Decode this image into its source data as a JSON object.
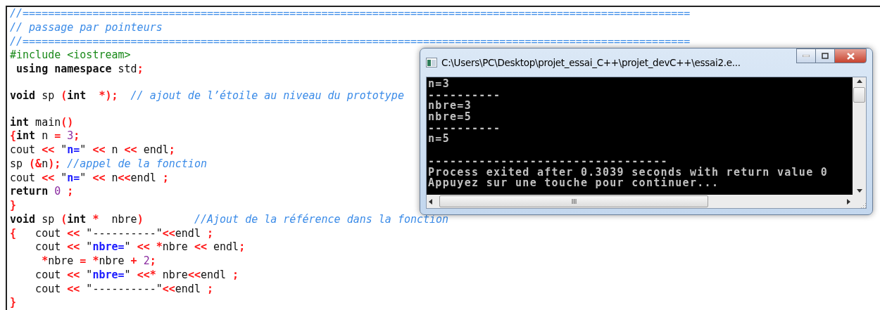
{
  "editor": {
    "lines": [
      {
        "kind": "code",
        "tokens": [
          {
            "kind": "comment",
            "text": "//========================================================================================================="
          }
        ]
      },
      {
        "kind": "code",
        "tokens": [
          {
            "kind": "comment",
            "text": "// passage par pointeurs"
          }
        ]
      },
      {
        "kind": "code",
        "tokens": [
          {
            "kind": "comment",
            "text": "//========================================================================================================="
          }
        ]
      },
      {
        "kind": "code",
        "tokens": [
          {
            "kind": "preproc",
            "text": "#include <iostream>"
          }
        ]
      },
      {
        "kind": "code",
        "tokens": [
          {
            "kind": "keyword",
            "text": " using namespace"
          },
          {
            "kind": "plain",
            "text": " std"
          },
          {
            "kind": "op",
            "text": ";"
          }
        ]
      },
      {
        "kind": "blank"
      },
      {
        "kind": "code",
        "tokens": [
          {
            "kind": "keyword",
            "text": "void"
          },
          {
            "kind": "plain",
            "text": " sp "
          },
          {
            "kind": "op",
            "text": "("
          },
          {
            "kind": "keyword",
            "text": "int"
          },
          {
            "kind": "op",
            "text": "  *);"
          },
          {
            "kind": "comment",
            "text": "  // ajout de l’étoile au niveau du prototype"
          }
        ]
      },
      {
        "kind": "blank"
      },
      {
        "kind": "code",
        "tokens": [
          {
            "kind": "keyword",
            "text": "int"
          },
          {
            "kind": "plain",
            "text": " main"
          },
          {
            "kind": "op",
            "text": "()"
          }
        ]
      },
      {
        "kind": "code",
        "tokens": [
          {
            "kind": "op",
            "text": "{"
          },
          {
            "kind": "keyword",
            "text": "int"
          },
          {
            "kind": "plain",
            "text": " n "
          },
          {
            "kind": "op",
            "text": "= "
          },
          {
            "kind": "number",
            "text": "3"
          },
          {
            "kind": "op",
            "text": ";"
          }
        ]
      },
      {
        "kind": "code",
        "tokens": [
          {
            "kind": "plain",
            "text": "cout "
          },
          {
            "kind": "op",
            "text": "<<"
          },
          {
            "kind": "plain",
            "text": " \""
          },
          {
            "kind": "string",
            "text": "n="
          },
          {
            "kind": "plain",
            "text": "\" "
          },
          {
            "kind": "op",
            "text": "<<"
          },
          {
            "kind": "plain",
            "text": " n "
          },
          {
            "kind": "op",
            "text": "<<"
          },
          {
            "kind": "plain",
            "text": " endl"
          },
          {
            "kind": "op",
            "text": ";"
          }
        ]
      },
      {
        "kind": "code",
        "tokens": [
          {
            "kind": "plain",
            "text": "sp "
          },
          {
            "kind": "op",
            "text": "(&"
          },
          {
            "kind": "plain",
            "text": "n"
          },
          {
            "kind": "op",
            "text": ");"
          },
          {
            "kind": "comment",
            "text": " //appel de la fonction"
          }
        ]
      },
      {
        "kind": "code",
        "tokens": [
          {
            "kind": "plain",
            "text": "cout "
          },
          {
            "kind": "op",
            "text": "<<"
          },
          {
            "kind": "plain",
            "text": " \""
          },
          {
            "kind": "string",
            "text": "n="
          },
          {
            "kind": "plain",
            "text": "\" "
          },
          {
            "kind": "op",
            "text": "<<"
          },
          {
            "kind": "plain",
            "text": " n"
          },
          {
            "kind": "op",
            "text": "<<"
          },
          {
            "kind": "plain",
            "text": "endl "
          },
          {
            "kind": "op",
            "text": ";"
          }
        ]
      },
      {
        "kind": "code",
        "tokens": [
          {
            "kind": "keyword",
            "text": "return "
          },
          {
            "kind": "number",
            "text": "0"
          },
          {
            "kind": "op",
            "text": " ;"
          }
        ]
      },
      {
        "kind": "code",
        "tokens": [
          {
            "kind": "op",
            "text": "}"
          }
        ]
      },
      {
        "kind": "code",
        "tokens": [
          {
            "kind": "keyword",
            "text": "void"
          },
          {
            "kind": "plain",
            "text": " sp "
          },
          {
            "kind": "op",
            "text": "("
          },
          {
            "kind": "keyword",
            "text": "int "
          },
          {
            "kind": "op",
            "text": "*"
          },
          {
            "kind": "plain",
            "text": "  nbre"
          },
          {
            "kind": "op",
            "text": ")"
          },
          {
            "kind": "comment",
            "text": "        //Ajout de la référence dans la fonction"
          }
        ]
      },
      {
        "kind": "code",
        "tokens": [
          {
            "kind": "op",
            "text": "{"
          },
          {
            "kind": "plain",
            "text": "   cout "
          },
          {
            "kind": "op",
            "text": "<<"
          },
          {
            "kind": "plain",
            "text": " \"----------\""
          },
          {
            "kind": "op",
            "text": "<<"
          },
          {
            "kind": "plain",
            "text": "endl "
          },
          {
            "kind": "op",
            "text": ";"
          }
        ]
      },
      {
        "kind": "code",
        "tokens": [
          {
            "kind": "plain",
            "text": "    cout "
          },
          {
            "kind": "op",
            "text": "<<"
          },
          {
            "kind": "plain",
            "text": " \""
          },
          {
            "kind": "string",
            "text": "nbre="
          },
          {
            "kind": "plain",
            "text": "\" "
          },
          {
            "kind": "op",
            "text": "<< *"
          },
          {
            "kind": "plain",
            "text": "nbre "
          },
          {
            "kind": "op",
            "text": "<<"
          },
          {
            "kind": "plain",
            "text": " endl"
          },
          {
            "kind": "op",
            "text": ";"
          }
        ]
      },
      {
        "kind": "code",
        "tokens": [
          {
            "kind": "op",
            "text": "     *"
          },
          {
            "kind": "plain",
            "text": "nbre "
          },
          {
            "kind": "op",
            "text": "= *"
          },
          {
            "kind": "plain",
            "text": "nbre "
          },
          {
            "kind": "op",
            "text": "+ "
          },
          {
            "kind": "number",
            "text": "2"
          },
          {
            "kind": "op",
            "text": ";"
          }
        ]
      },
      {
        "kind": "code",
        "tokens": [
          {
            "kind": "plain",
            "text": "    cout "
          },
          {
            "kind": "op",
            "text": "<<"
          },
          {
            "kind": "plain",
            "text": " \""
          },
          {
            "kind": "string",
            "text": "nbre="
          },
          {
            "kind": "plain",
            "text": "\" "
          },
          {
            "kind": "op",
            "text": "<<*"
          },
          {
            "kind": "plain",
            "text": " nbre"
          },
          {
            "kind": "op",
            "text": "<<"
          },
          {
            "kind": "plain",
            "text": "endl "
          },
          {
            "kind": "op",
            "text": ";"
          }
        ]
      },
      {
        "kind": "code",
        "tokens": [
          {
            "kind": "plain",
            "text": "    cout "
          },
          {
            "kind": "op",
            "text": "<<"
          },
          {
            "kind": "plain",
            "text": " \"----------\""
          },
          {
            "kind": "op",
            "text": "<<"
          },
          {
            "kind": "plain",
            "text": "endl "
          },
          {
            "kind": "op",
            "text": ";"
          }
        ]
      },
      {
        "kind": "code",
        "tokens": [
          {
            "kind": "op",
            "text": "}"
          }
        ]
      }
    ]
  },
  "console_window": {
    "title": "C:\\Users\\PC\\Desktop\\projet_essai_C++\\projet_devC++\\essai2.e...",
    "lines": [
      {
        "kind": "text",
        "text": "n=3"
      },
      {
        "kind": "text",
        "text": "----------"
      },
      {
        "kind": "text",
        "text": "nbre=3"
      },
      {
        "kind": "text",
        "text": "nbre=5"
      },
      {
        "kind": "text",
        "text": "----------"
      },
      {
        "kind": "text",
        "text": "n=5"
      },
      {
        "kind": "blank"
      },
      {
        "kind": "text",
        "text": "---------------------------------"
      },
      {
        "kind": "text",
        "text": "Process exited after 0.3039 seconds with return value 0"
      },
      {
        "kind": "text",
        "text": "Appuyez sur une touche pour continuer..."
      }
    ]
  }
}
